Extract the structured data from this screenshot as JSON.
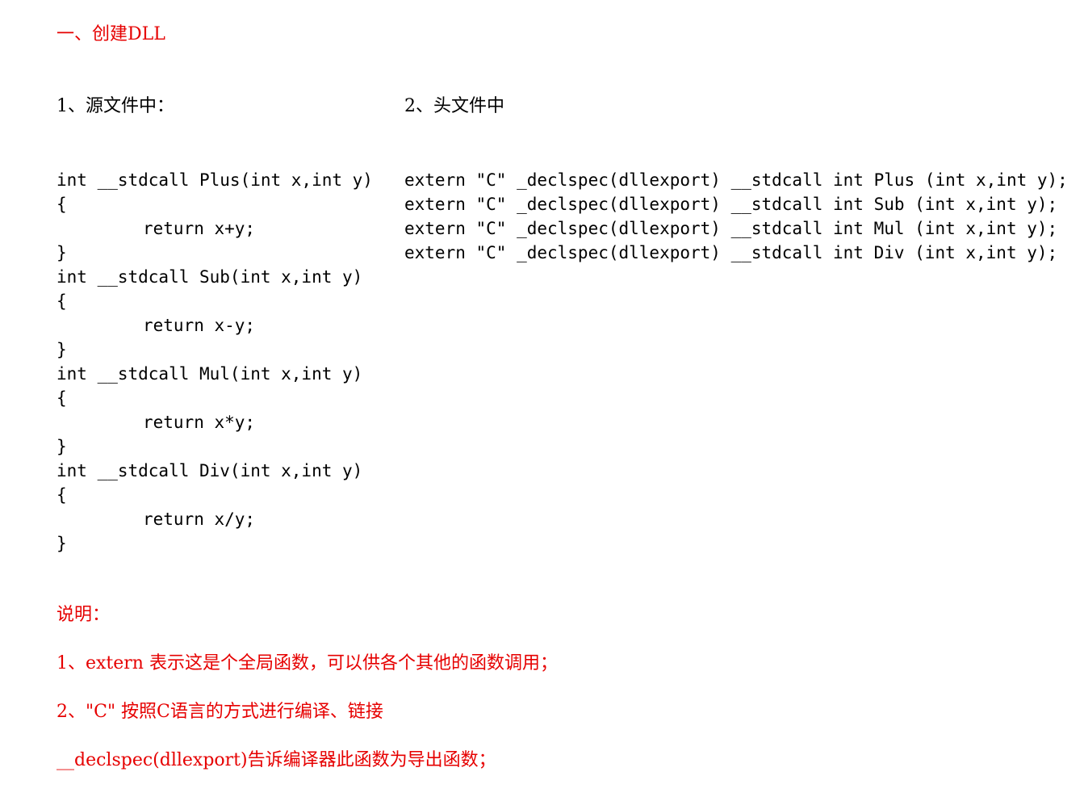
{
  "heading": "一、创建DLL",
  "source_section": {
    "title": "1、源文件中：",
    "lines": [
      "int __stdcall Plus(int x,int y)",
      "{",
      "return x+y;",
      "}",
      "int __stdcall Sub(int x,int y)",
      "{",
      "return x-y;",
      "}",
      "int __stdcall Mul(int x,int y)",
      "{",
      "return x*y;",
      "}",
      "int __stdcall Div(int x,int y)",
      "{",
      "return x/y;",
      "}"
    ]
  },
  "header_section": {
    "title": "2、头文件中",
    "lines": [
      "extern \"C\" _declspec(dllexport) __stdcall int Plus (int x,int y);",
      "extern \"C\" _declspec(dllexport) __stdcall int Sub (int x,int y);",
      "extern \"C\" _declspec(dllexport) __stdcall int Mul (int x,int y);",
      "extern \"C\" _declspec(dllexport) __stdcall int Div (int x,int y);"
    ]
  },
  "notes": {
    "title": "说明：",
    "items": [
      "1、extern 表示这是个全局函数，可以供各个其他的函数调用；",
      "2、\"C\" 按照C语言的方式进行编译、链接",
      "__declspec(dllexport)告诉编译器此函数为导出函数；"
    ]
  },
  "colors": {
    "accent_red": "#e60000",
    "text": "#000000"
  }
}
